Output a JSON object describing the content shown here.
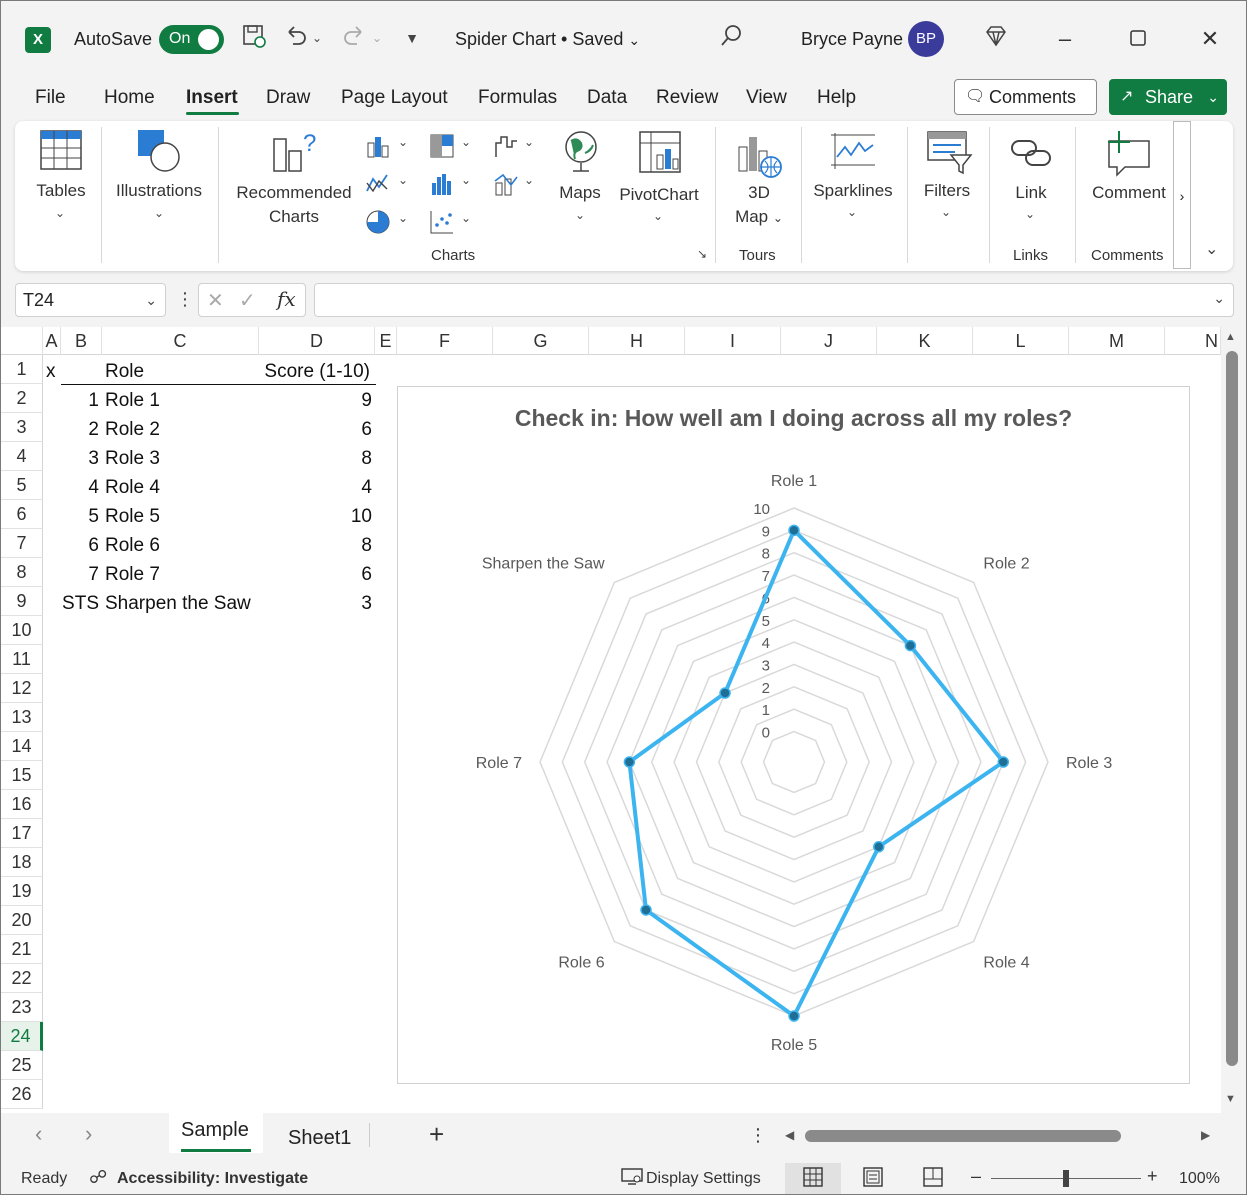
{
  "titlebar": {
    "app_logo": "X",
    "autosave_label": "AutoSave",
    "autosave_state": "On",
    "document_title": "Spider Chart • Saved",
    "user_name": "Bryce Payne",
    "user_initials": "BP"
  },
  "menu": {
    "tabs": [
      "File",
      "Home",
      "Insert",
      "Draw",
      "Page Layout",
      "Formulas",
      "Data",
      "Review",
      "View",
      "Help"
    ],
    "active": "Insert",
    "comments_label": "Comments",
    "share_label": "Share"
  },
  "ribbon": {
    "tables": "Tables",
    "illustrations": "Illustrations",
    "recommended_charts_1": "Recommended",
    "recommended_charts_2": "Charts",
    "maps": "Maps",
    "pivotchart": "PivotChart",
    "map3d_1": "3D",
    "map3d_2": "Map",
    "sparklines": "Sparklines",
    "filters": "Filters",
    "link": "Link",
    "comment": "Comment",
    "group_charts": "Charts",
    "group_tours": "Tours",
    "group_links": "Links",
    "group_comments": "Comments"
  },
  "formula_bar": {
    "name_box": "T24",
    "fx_symbol": "fx",
    "formula": ""
  },
  "columns": [
    "A",
    "B",
    "C",
    "D",
    "E",
    "F",
    "G",
    "H",
    "I",
    "J",
    "K",
    "L",
    "M",
    "N"
  ],
  "rows": [
    "1",
    "2",
    "3",
    "4",
    "5",
    "6",
    "7",
    "8",
    "9",
    "10",
    "11",
    "12",
    "13",
    "14",
    "15",
    "16",
    "17",
    "18",
    "19",
    "20",
    "21",
    "22",
    "23",
    "24",
    "25",
    "26"
  ],
  "cells": {
    "a1": "x",
    "c1": "Role",
    "d1": "Score (1-10)",
    "table": [
      {
        "b": "1",
        "c": "Role 1",
        "d": "9"
      },
      {
        "b": "2",
        "c": "Role 2",
        "d": "6"
      },
      {
        "b": "3",
        "c": "Role 3",
        "d": "8"
      },
      {
        "b": "4",
        "c": "Role 4",
        "d": "4"
      },
      {
        "b": "5",
        "c": "Role 5",
        "d": "10"
      },
      {
        "b": "6",
        "c": "Role 6",
        "d": "8"
      },
      {
        "b": "7",
        "c": "Role 7",
        "d": "6"
      },
      {
        "b": "STS",
        "c": "Sharpen the Saw",
        "d": "3"
      }
    ]
  },
  "chart_data": {
    "type": "radar",
    "title": "Check in: How well am I doing across all my roles?",
    "categories": [
      "Role 1",
      "Role 2",
      "Role 3",
      "Role 4",
      "Role 5",
      "Role 6",
      "Role 7",
      "Sharpen the Saw"
    ],
    "series": [
      {
        "values": [
          9,
          6,
          8,
          4,
          10,
          8,
          6,
          3
        ],
        "color": "#3cb4f0"
      }
    ],
    "axis_ticks": [
      "0",
      "1",
      "2",
      "3",
      "4",
      "5",
      "6",
      "7",
      "8",
      "9",
      "10"
    ],
    "rmin": 0,
    "rmax": 10,
    "grid": true,
    "legend": "none"
  },
  "sheets": {
    "tabs": [
      "Sample",
      "Sheet1"
    ],
    "active": "Sample"
  },
  "status": {
    "ready": "Ready",
    "accessibility": "Accessibility: Investigate",
    "display_settings": "Display Settings",
    "zoom": "100%"
  },
  "colors": {
    "accent": "#107c41",
    "series": "#3cb4f0"
  }
}
